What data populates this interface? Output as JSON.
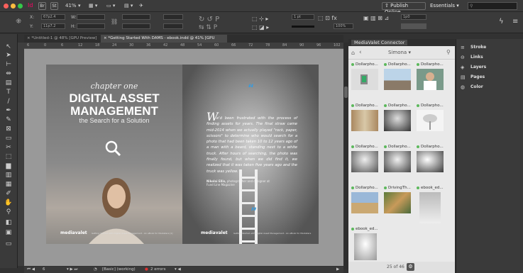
{
  "menubar": {
    "zoom": "41%",
    "publish": "Publish Online",
    "essentials": "Essentials"
  },
  "control": {
    "x_label": "X:",
    "x_value": "67p2.4",
    "y_label": "Y:",
    "y_value": "11p7.2",
    "w_label": "W:",
    "h_label": "H:",
    "stroke_weight": "1 pt",
    "opacity": "100%",
    "size_value": "1p0"
  },
  "tabs": [
    {
      "label": "*Untitled-1 @ 48% [GPU Preview]"
    },
    {
      "label": "*Getting Started With DAMS - ebook.indd @ 41% [GPU Preview]"
    }
  ],
  "ruler": [
    "6",
    "0",
    "6",
    "12",
    "18",
    "24",
    "30",
    "36",
    "42",
    "48",
    "54",
    "60",
    "66",
    "72",
    "78",
    "84",
    "90",
    "96",
    "102"
  ],
  "left_page": {
    "script": "chapter one",
    "title1": "DIGITAL ASSET",
    "title2": "MANAGEMENT",
    "subtitle": "the Search for a Solution",
    "logo": "mediavalet",
    "footer": "Getting Started with Digital Asset Management - An eBook for Marketers [1]"
  },
  "right_page": {
    "quote_mark": "“",
    "drop_cap": "W",
    "quote": "e'd been frustrated with the process of finding assets for years. The final straw came mid-2014 when we actually played \"rock, paper, scissors\" to determine who would search for a photo that had been taken 10 to 12 years ago of a man with a beard, standing next to a white truck. After hours of searching, the photo was finally found, but when we did find it, we realized that it was taken five years ago and the truck was yellow.",
    "attribution_name": "Nikolai Ellis,",
    "attribution_rest": " photographer and designer at Fund Line Magazine",
    "quote_end": "”",
    "logo": "mediavalet",
    "footer": "Getting Started with Digital Asset Management - An eBook for Marketers [2]"
  },
  "status": {
    "page": "6",
    "style": "[Basic] (working)",
    "errors": "2 errors"
  },
  "panel": {
    "title": "MediaValet Connector",
    "folder": "Simona",
    "pagination": "25 of 46",
    "assets": [
      {
        "name": "Dollarpho..."
      },
      {
        "name": "Dollarpho..."
      },
      {
        "name": "Dollarpho..."
      },
      {
        "name": "Dollarpho..."
      },
      {
        "name": "Dollarpho..."
      },
      {
        "name": "Dollarpho..."
      },
      {
        "name": "Dollarpho..."
      },
      {
        "name": "Dollarpho..."
      },
      {
        "name": "Dollarpho..."
      },
      {
        "name": "Dollarpho..."
      },
      {
        "name": "DrivingTh..."
      },
      {
        "name": "ebook_ed..."
      },
      {
        "name": "ebook_ed..."
      }
    ]
  },
  "right_panel": {
    "items": [
      {
        "label": "Stroke",
        "icon": "stroke-icon"
      },
      {
        "label": "Links",
        "icon": "links-icon"
      },
      {
        "label": "Layers",
        "icon": "layers-icon"
      },
      {
        "label": "Pages",
        "icon": "pages-icon"
      },
      {
        "label": "Color",
        "icon": "color-icon"
      }
    ]
  }
}
